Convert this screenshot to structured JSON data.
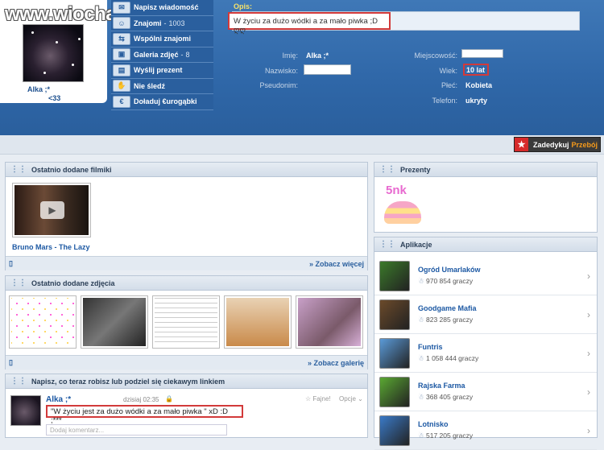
{
  "watermark": "www.wiocha.pl",
  "profile": {
    "name": "Alka ;*",
    "age_tag": "<33"
  },
  "menu": [
    {
      "icon": "envelope-icon",
      "glyph": "✉",
      "label": "Napisz wiadomość",
      "count": ""
    },
    {
      "icon": "people-icon",
      "glyph": "☺",
      "label": "Znajomi",
      "count": "1003"
    },
    {
      "icon": "mutual-friends-icon",
      "glyph": "⇆",
      "label": "Wspólni znajomi",
      "count": ""
    },
    {
      "icon": "camera-icon",
      "glyph": "▣",
      "label": "Galeria zdjęć",
      "count": "8"
    },
    {
      "icon": "gift-icon",
      "glyph": "▤",
      "label": "Wyślij prezent",
      "count": ""
    },
    {
      "icon": "poke-icon",
      "glyph": "✋",
      "label": "Nie śledź",
      "count": ""
    },
    {
      "icon": "euro-icon",
      "glyph": "€",
      "label": "Doładuj €urogąbki",
      "count": ""
    }
  ],
  "opis": {
    "label": "Opis:",
    "text": "W życiu za dużo wódki a za mało piwka ;D ღღ"
  },
  "fields": {
    "imie_label": "Imię:",
    "imie": "Alka ;*",
    "nazwisko_label": "Nazwisko:",
    "pseudonim_label": "Pseudonim:",
    "miejscowosc_label": "Miejscowość:",
    "wiek_label": "Wiek:",
    "wiek": "10 lat",
    "plec_label": "Płeć:",
    "plec": "Kobieta",
    "telefon_label": "Telefon:",
    "telefon": "ukryty"
  },
  "dedykuj": {
    "label": "Zadedykuj",
    "accent": "Przebój"
  },
  "filmiki": {
    "title": "Ostatnio dodane filmiki",
    "video_title": "Bruno Mars - The Lazy",
    "more": "» Zobacz więcej"
  },
  "zdjecia": {
    "title": "Ostatnio dodane zdjęcia",
    "more": "» Zobacz galerię"
  },
  "post": {
    "prompt": "Napisz, co teraz robisz lub podziel się ciekawym linkiem",
    "author": "Alka ;*",
    "time": "dzisiaj 02:35",
    "like": "Fajne!",
    "options": "Opcje",
    "text": "\"W życiu jest za dużo wódki a za mało piwka \" xD :D ;***",
    "comment_placeholder": "Dodaj komentarz..."
  },
  "prezenty": {
    "title": "Prezenty",
    "gift_text": "5nk"
  },
  "aplikacje": {
    "title": "Aplikacje",
    "items": [
      {
        "name": "Ogród Umarlaków",
        "players": "970 854 graczy",
        "color": "#3b7a2a"
      },
      {
        "name": "Goodgame Mafia",
        "players": "823 285 graczy",
        "color": "#6b4a2a"
      },
      {
        "name": "Funtris",
        "players": "1 058 444 graczy",
        "color": "#5a9ad8"
      },
      {
        "name": "Rajska Farma",
        "players": "368 405 graczy",
        "color": "#5aa832"
      },
      {
        "name": "Lotnisko",
        "players": "517 205 graczy",
        "color": "#3a7ac8"
      }
    ]
  }
}
